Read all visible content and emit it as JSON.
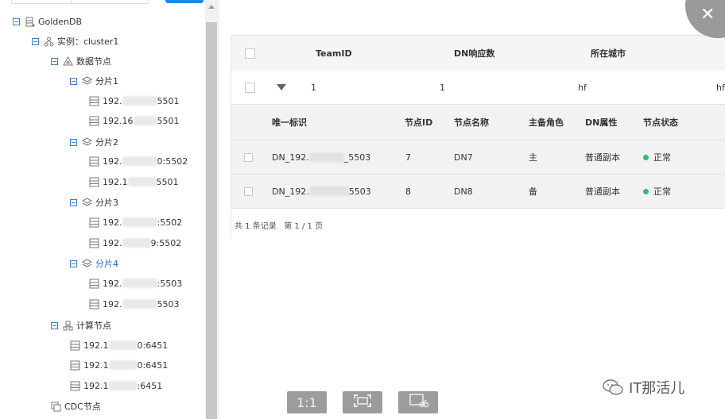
{
  "tree": {
    "root": "GoldenDB",
    "instance": "实例：cluster1",
    "data_nodes": "数据节点",
    "shards": [
      {
        "label": "分片1",
        "hosts": [
          {
            "pre": "192.",
            "suf": "5501"
          },
          {
            "pre": "192.16",
            "suf": "5501"
          }
        ]
      },
      {
        "label": "分片2",
        "hosts": [
          {
            "pre": "192.",
            "suf": "0:5502"
          },
          {
            "pre": "192.1",
            "suf": "5501"
          }
        ]
      },
      {
        "label": "分片3",
        "hosts": [
          {
            "pre": "192.",
            "suf": ":5502"
          },
          {
            "pre": "192.",
            "suf": "9:5502"
          }
        ]
      },
      {
        "label": "分片4",
        "hosts": [
          {
            "pre": "192.",
            "suf": ":5503"
          },
          {
            "pre": "192.",
            "suf": "5503"
          }
        ]
      }
    ],
    "compute_nodes": "计算节点",
    "compute_hosts": [
      {
        "pre": "192.1",
        "suf": "0:6451"
      },
      {
        "pre": "192.1",
        "suf": "0:6451"
      },
      {
        "pre": "192.1",
        "suf": ":6451"
      }
    ],
    "cdc_nodes": "CDC节点"
  },
  "table": {
    "headers": [
      "TeamID",
      "DN响应数",
      "所在城市"
    ],
    "row": {
      "team_id": "1",
      "dn_count": "1",
      "city": "hf",
      "city2": "hf"
    },
    "sub_headers": [
      "唯一标识",
      "节点ID",
      "节点名称",
      "主备角色",
      "DN属性",
      "节点状态"
    ],
    "sub_rows": [
      {
        "id_pre": "DN_192.",
        "id_suf": "_5503",
        "node_id": "7",
        "name": "DN7",
        "role": "主",
        "attr": "普通副本",
        "status": "正常"
      },
      {
        "id_pre": "DN_192.",
        "id_suf": "5503",
        "node_id": "8",
        "name": "DN8",
        "role": "备",
        "attr": "普通副本",
        "status": "正常"
      }
    ],
    "footer": "共 1 条记录   第 1 / 1 页"
  },
  "toolbar": {
    "actual_size": "1:1"
  },
  "watermark": "IT那活儿",
  "colors": {
    "accent": "#1e88e5",
    "status_ok": "#2fbf71",
    "tree_active": "#1a73c9"
  }
}
